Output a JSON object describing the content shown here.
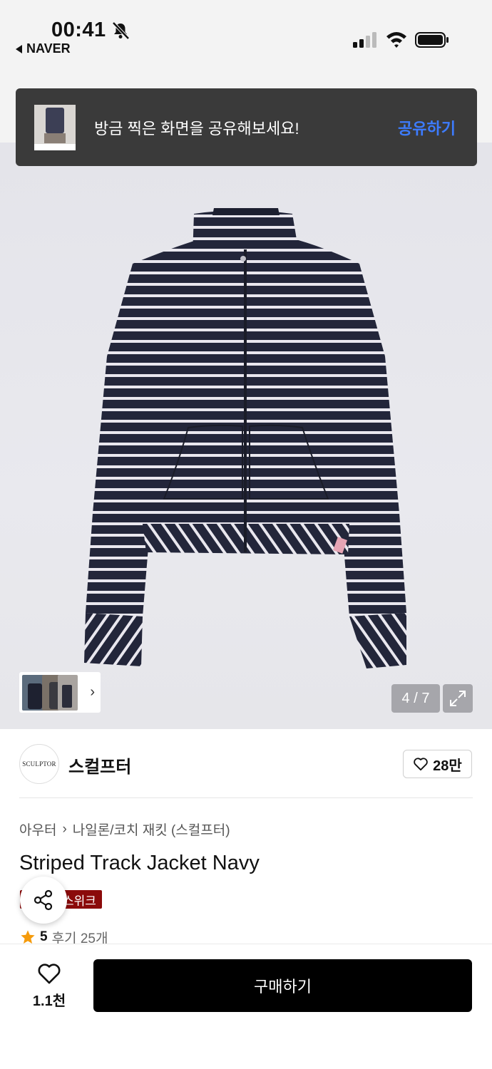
{
  "status": {
    "time": "00:41",
    "back_app": "NAVER",
    "icons": [
      "bell-slash-icon",
      "signal-icon",
      "wifi-icon",
      "battery-icon"
    ]
  },
  "toast": {
    "message": "방금 찍은 화면을 공유해보세요!",
    "action": "공유하기",
    "action_color": "#3d7cff"
  },
  "gallery": {
    "counter": "4 / 7",
    "current": 4,
    "total": 7
  },
  "brand": {
    "logo_text": "SCULPTOR",
    "name": "스컬프터",
    "likes": "28만"
  },
  "product": {
    "breadcrumb": [
      "아우터",
      "나일론/코치 재킷 (스컬프터)"
    ],
    "title": "Striped Track Jacket Navy",
    "badge": "스위크",
    "badge_color": "#8b0a0a",
    "rating": "5",
    "reviews": "후기 25개"
  },
  "bottom": {
    "wish_count": "1.1천",
    "buy_label": "구매하기"
  }
}
